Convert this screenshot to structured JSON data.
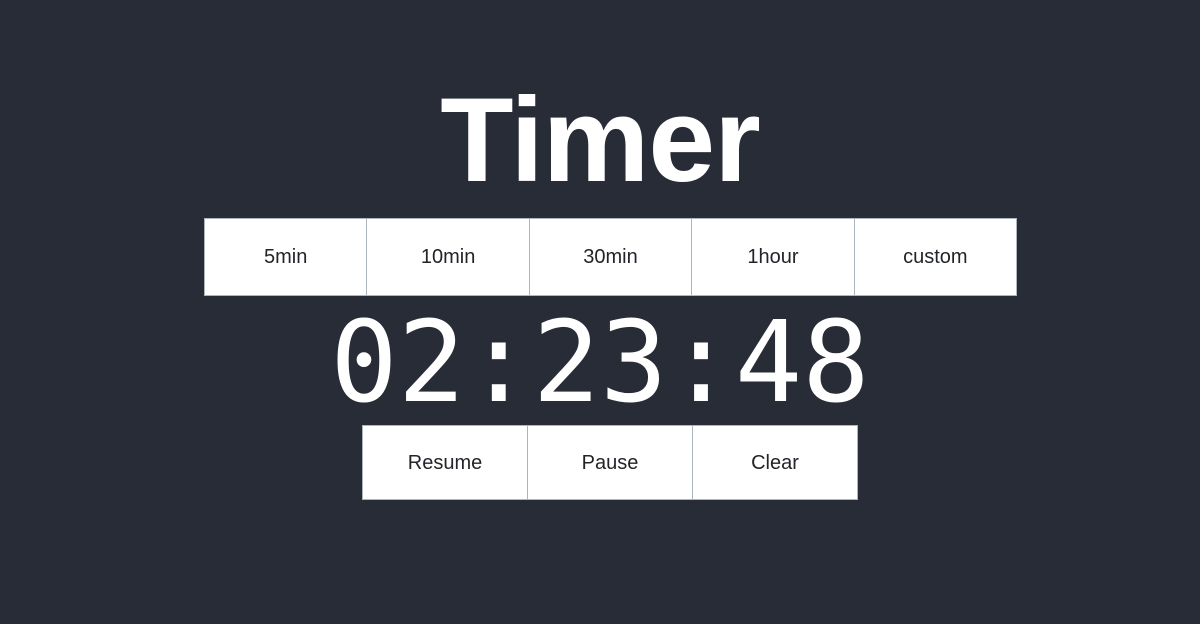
{
  "app": {
    "title": "Timer",
    "background_color": "#282c36",
    "button_background_color": "#ffffff",
    "button_text_color": "#212529",
    "button_border_color": "#adb5bd",
    "title_color": "#ffffff",
    "timer_color": "#ffffff"
  },
  "presets": [
    {
      "label": "5min"
    },
    {
      "label": "10min"
    },
    {
      "label": "30min"
    },
    {
      "label": "1hour"
    },
    {
      "label": "custom"
    }
  ],
  "timer": {
    "value": "02:23:48",
    "hours": "02",
    "minutes": "23",
    "seconds": "48"
  },
  "controls": [
    {
      "label": "Resume"
    },
    {
      "label": "Pause"
    },
    {
      "label": "Clear"
    }
  ]
}
